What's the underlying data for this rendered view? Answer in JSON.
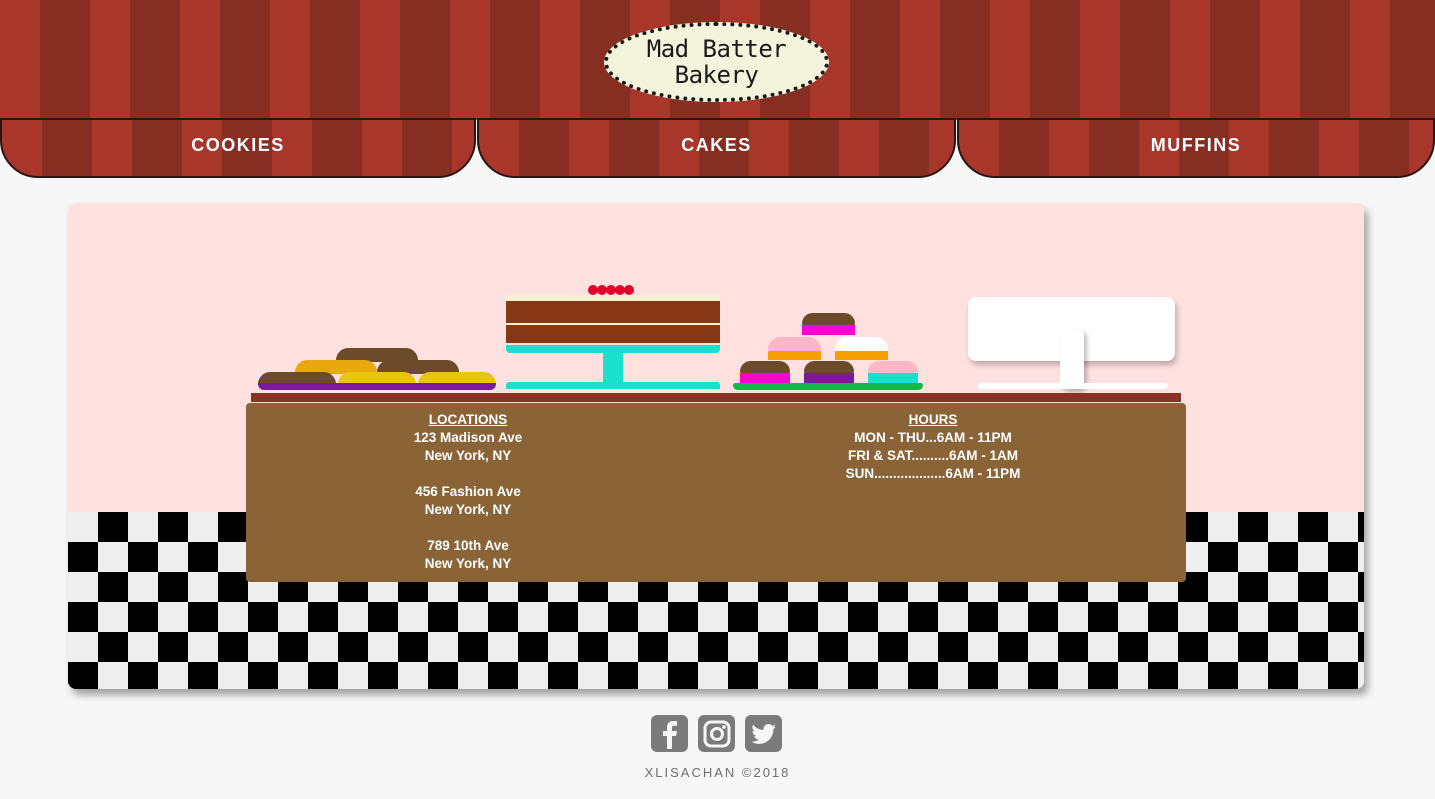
{
  "brand": {
    "line1": "Mad Batter",
    "line2": "Bakery"
  },
  "nav": {
    "items": [
      {
        "label": "COOKIES"
      },
      {
        "label": "CAKES"
      },
      {
        "label": "MUFFINS"
      }
    ]
  },
  "info": {
    "locations_title": "LOCATIONS",
    "locations": [
      {
        "street": "123 Madison Ave",
        "city": "New York, NY"
      },
      {
        "street": "456 Fashion Ave",
        "city": "New York, NY"
      },
      {
        "street": "789 10th Ave",
        "city": "New York, NY"
      }
    ],
    "hours_title": "HOURS",
    "hours": [
      "MON - THU...6AM - 11PM",
      "FRI & SAT..........6AM - 1AM",
      "SUN...................6AM - 11PM"
    ]
  },
  "social": {
    "icons": [
      "facebook-icon",
      "instagram-icon",
      "twitter-icon"
    ]
  },
  "footer": {
    "copyright": "XLISACHAN ©2018"
  },
  "colors": {
    "awning_red": "#a8362a",
    "awning_dark": "#872e23",
    "counter_brown": "#8a6437",
    "wall_pink": "#ffe1df"
  }
}
